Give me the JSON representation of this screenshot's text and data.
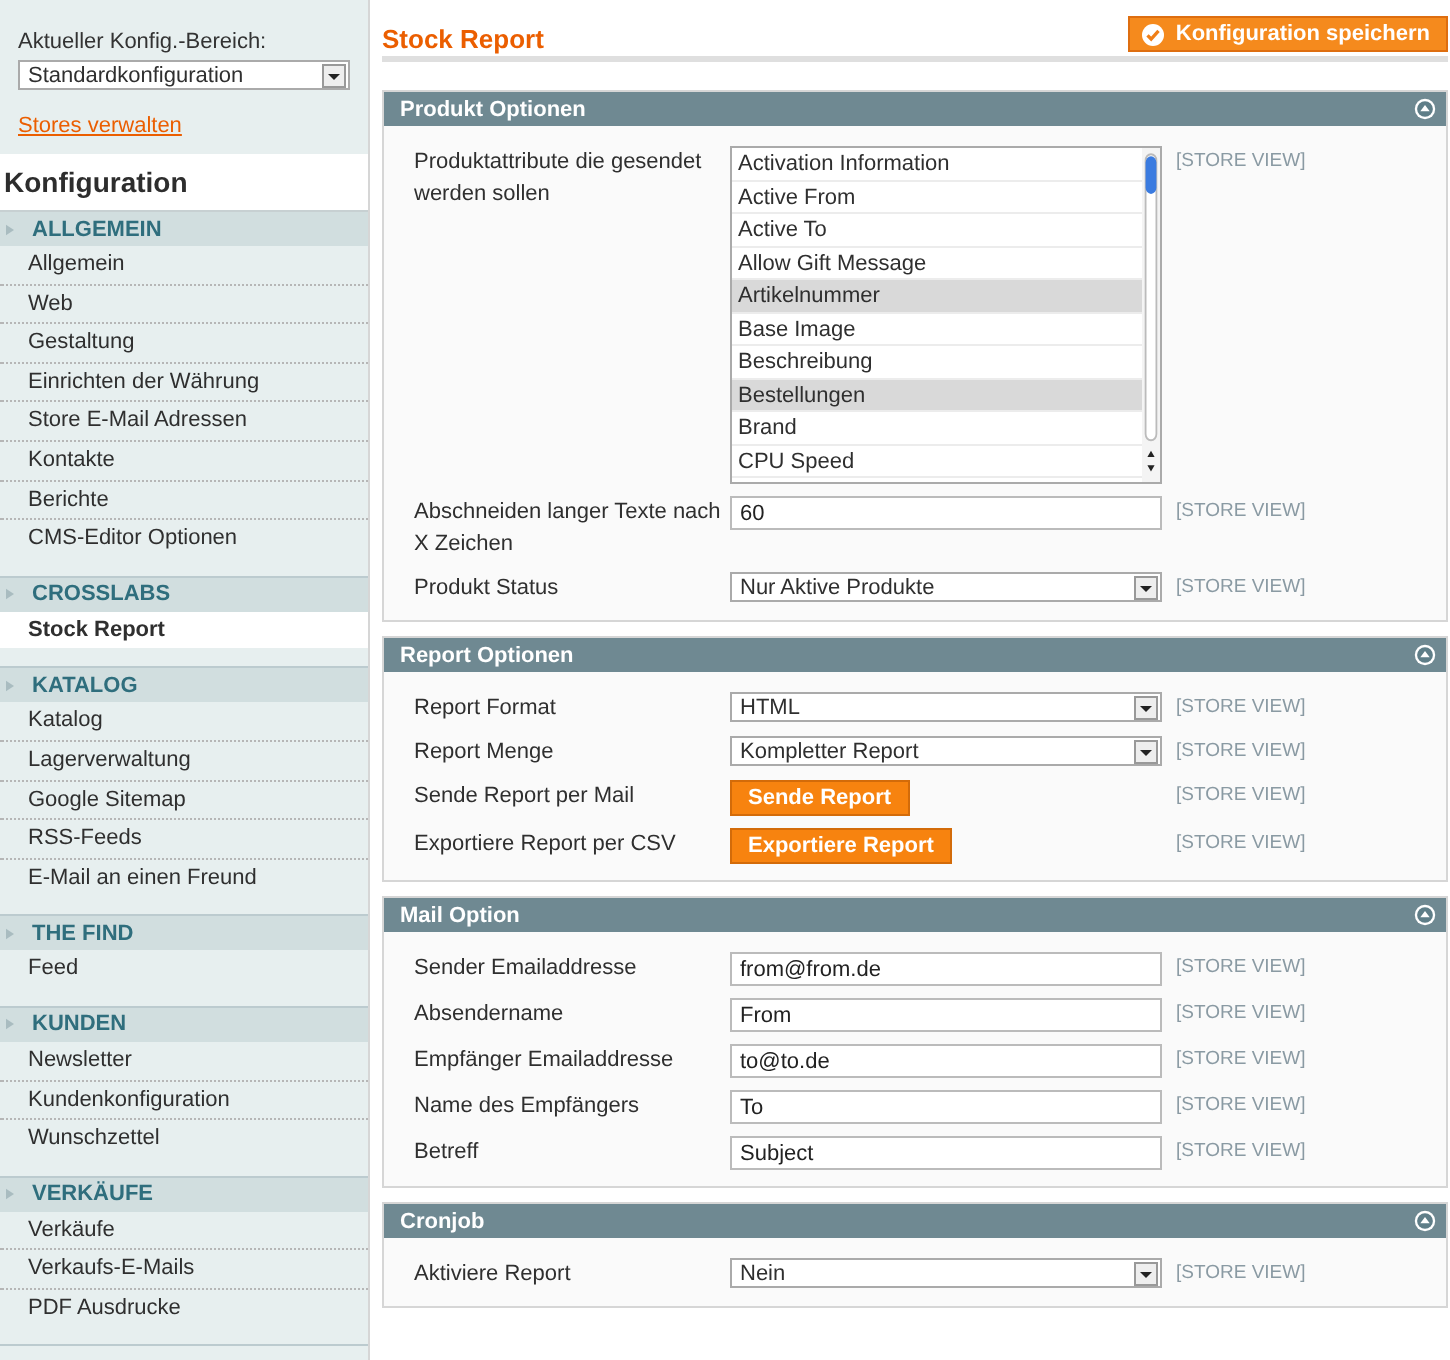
{
  "scope_switcher": {
    "label": "Aktueller Konfig.-Bereich:",
    "value": "Standardkonfiguration",
    "link": "Stores verwalten"
  },
  "sidebar": {
    "title": "Konfiguration",
    "groups": [
      {
        "title": "ALLGEMEIN",
        "items": [
          {
            "label": "Allgemein",
            "selected": false
          },
          {
            "label": "Web",
            "selected": false
          },
          {
            "label": "Gestaltung",
            "selected": false
          },
          {
            "label": "Einrichten der Währung",
            "selected": false
          },
          {
            "label": "Store E-Mail Adressen",
            "selected": false
          },
          {
            "label": "Kontakte",
            "selected": false
          },
          {
            "label": "Berichte",
            "selected": false
          },
          {
            "label": "CMS-Editor Optionen",
            "selected": false
          }
        ]
      },
      {
        "title": "CROSSLABS",
        "items": [
          {
            "label": "Stock Report",
            "selected": true
          }
        ]
      },
      {
        "title": "KATALOG",
        "items": [
          {
            "label": "Katalog",
            "selected": false
          },
          {
            "label": "Lagerverwaltung",
            "selected": false
          },
          {
            "label": "Google Sitemap",
            "selected": false
          },
          {
            "label": "RSS-Feeds",
            "selected": false
          },
          {
            "label": "E-Mail an einen Freund",
            "selected": false
          }
        ]
      },
      {
        "title": "THE FIND",
        "items": [
          {
            "label": "Feed",
            "selected": false
          }
        ]
      },
      {
        "title": "KUNDEN",
        "items": [
          {
            "label": "Newsletter",
            "selected": false
          },
          {
            "label": "Kundenkonfiguration",
            "selected": false
          },
          {
            "label": "Wunschzettel",
            "selected": false
          }
        ]
      },
      {
        "title": "VERKÄUFE",
        "items": [
          {
            "label": "Verkäufe",
            "selected": false
          },
          {
            "label": "Verkaufs-E-Mails",
            "selected": false
          },
          {
            "label": "PDF Ausdrucke",
            "selected": false
          }
        ]
      }
    ]
  },
  "page": {
    "title": "Stock Report",
    "save_button": "Konfiguration speichern"
  },
  "sections": [
    {
      "title": "Produkt Optionen",
      "fields": [
        {
          "kind": "multiselect",
          "label": "Produktattribute die gesendet werden sollen",
          "scope": "[STORE VIEW]",
          "options": [
            {
              "label": "Activation Information",
              "selected": false
            },
            {
              "label": "Active From",
              "selected": false
            },
            {
              "label": "Active To",
              "selected": false
            },
            {
              "label": "Allow Gift Message",
              "selected": false
            },
            {
              "label": "Artikelnummer",
              "selected": true
            },
            {
              "label": "Base Image",
              "selected": false
            },
            {
              "label": "Beschreibung",
              "selected": false
            },
            {
              "label": "Bestellungen",
              "selected": true
            },
            {
              "label": "Brand",
              "selected": false
            },
            {
              "label": "CPU Speed",
              "selected": false
            }
          ]
        },
        {
          "kind": "text",
          "label": "Abschneiden langer Texte nach X Zeichen",
          "value": "60",
          "scope": "[STORE VIEW]"
        },
        {
          "kind": "select",
          "label": "Produkt Status",
          "value": "Nur Aktive Produkte",
          "scope": "[STORE VIEW]"
        }
      ]
    },
    {
      "title": "Report Optionen",
      "fields": [
        {
          "kind": "select",
          "label": "Report Format",
          "value": "HTML",
          "scope": "[STORE VIEW]"
        },
        {
          "kind": "select",
          "label": "Report Menge",
          "value": "Kompletter Report",
          "scope": "[STORE VIEW]"
        },
        {
          "kind": "button",
          "label": "Sende Report per Mail",
          "value": "Sende Report",
          "scope": "[STORE VIEW]"
        },
        {
          "kind": "button",
          "label": "Exportiere Report per CSV",
          "value": "Exportiere Report",
          "scope": "[STORE VIEW]"
        }
      ]
    },
    {
      "title": "Mail Option",
      "fields": [
        {
          "kind": "text",
          "label": "Sender Emailaddresse",
          "value": "from@from.de",
          "scope": "[STORE VIEW]"
        },
        {
          "kind": "text",
          "label": "Absendername",
          "value": "From",
          "scope": "[STORE VIEW]"
        },
        {
          "kind": "text",
          "label": "Empfänger Emailaddresse",
          "value": "to@to.de",
          "scope": "[STORE VIEW]"
        },
        {
          "kind": "text",
          "label": "Name des Empfängers",
          "value": "To",
          "scope": "[STORE VIEW]"
        },
        {
          "kind": "text",
          "label": "Betreff",
          "value": "Subject",
          "scope": "[STORE VIEW]"
        }
      ]
    },
    {
      "title": "Cronjob",
      "fields": [
        {
          "kind": "select",
          "label": "Aktiviere Report",
          "value": "Nein",
          "scope": "[STORE VIEW]"
        }
      ]
    }
  ]
}
